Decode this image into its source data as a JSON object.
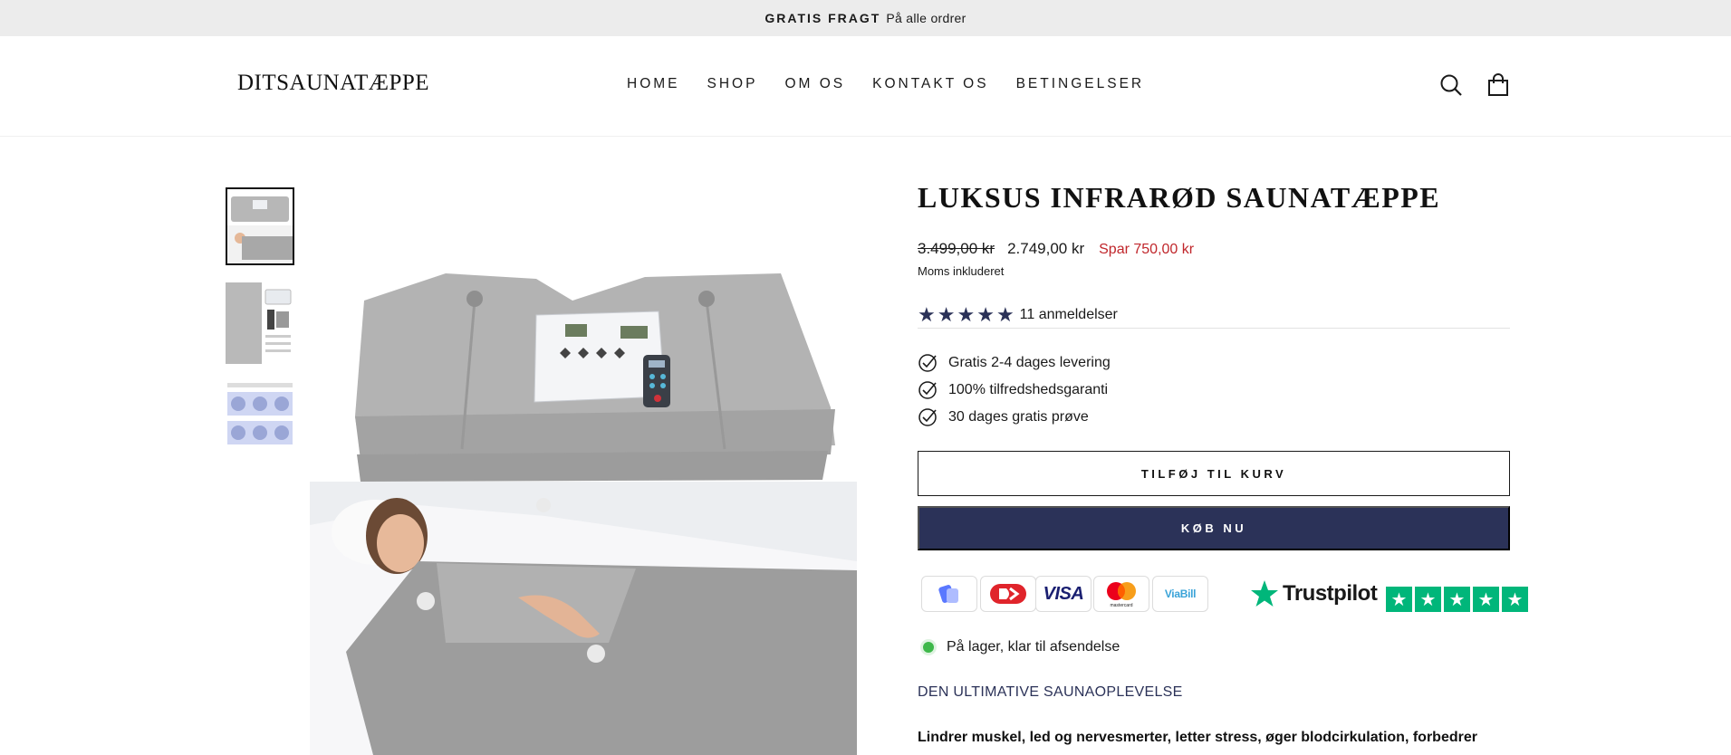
{
  "announcement": {
    "strong": "GRATIS FRAGT",
    "text": "På alle ordrer"
  },
  "header": {
    "logo": "DITSAUNATÆPPE",
    "nav": [
      "HOME",
      "SHOP",
      "OM OS",
      "KONTAKT OS",
      "BETINGELSER"
    ],
    "icons": [
      "search-icon",
      "cart-icon"
    ]
  },
  "gallery": {
    "thumbnail_count": 3
  },
  "product": {
    "title": "LUKSUS INFRARØD SAUNATÆPPE",
    "old_price": "3.499,00 kr",
    "price": "2.749,00 kr",
    "save": "Spar 750,00 kr",
    "tax_note": "Moms inkluderet",
    "rating": {
      "stars": 5,
      "reviews": "11 anmeldelser"
    },
    "features": [
      "Gratis 2-4 dages levering",
      "100% tilfredshedsgaranti",
      "30 dages gratis prøve"
    ],
    "add_to_cart": "TILFØJ TIL KURV",
    "buy_now": "KØB NU",
    "payment_methods": [
      "MobilePay",
      "Dankort",
      "VISA",
      "mastercard",
      "ViaBill"
    ],
    "trustpilot": "Trustpilot",
    "stock": "På lager, klar til afsendelse",
    "subheading": "DEN ULTIMATIVE SAUNAOPLEVELSE",
    "description": "Lindrer muskel, led og nervesmerter, letter stress, øger blodcirkulation, forbedrer"
  },
  "colors": {
    "accent": "#2b3258",
    "sale": "#c0262b",
    "announce_bg": "#ececec",
    "trustpilot": "#00b67a",
    "stock": "#3eb84a"
  }
}
